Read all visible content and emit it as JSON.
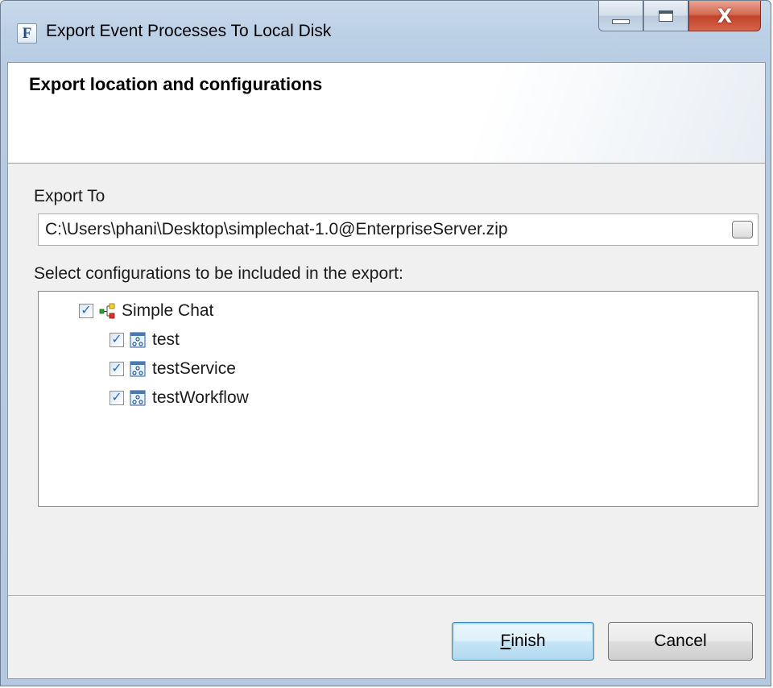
{
  "window": {
    "title": "Export Event Processes To Local Disk",
    "app_icon_letter": "F",
    "controls": [
      "minimize",
      "maximize",
      "close"
    ],
    "close_glyph": "X"
  },
  "banner": {
    "title": "Export location and configurations"
  },
  "export_to": {
    "label": "Export To",
    "value": "C:\\Users\\phani\\Desktop\\simplechat-1.0@EnterpriseServer.zip"
  },
  "configurations": {
    "label": "Select configurations to be included in the export:",
    "root": {
      "label": "Simple Chat",
      "checked": true,
      "icon": "project-tree-icon"
    },
    "items": [
      {
        "label": "test",
        "checked": true,
        "icon": "configuration-icon"
      },
      {
        "label": "testService",
        "checked": true,
        "icon": "configuration-icon"
      },
      {
        "label": "testWorkflow",
        "checked": true,
        "icon": "configuration-icon"
      }
    ]
  },
  "buttons": {
    "finish_mnemonic": "F",
    "finish_rest": "inish",
    "cancel": "Cancel"
  },
  "colors": {
    "default_button_border": "#3c7fb1",
    "check_mark": "#2a6bbd",
    "close_button": "#c2432a"
  }
}
